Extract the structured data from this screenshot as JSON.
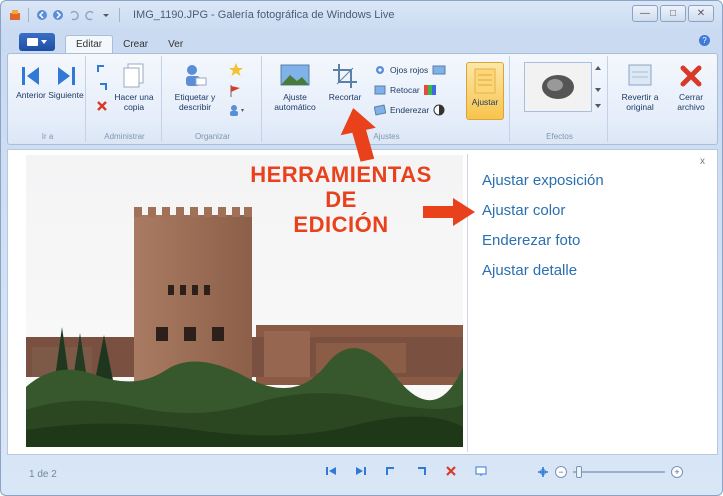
{
  "window": {
    "title": "IMG_1190.JPG - Galería fotográfica de Windows Live",
    "controls": [
      "minimize",
      "maximize",
      "close"
    ]
  },
  "tabs": [
    {
      "label": "Editar",
      "active": true
    },
    {
      "label": "Crear",
      "active": false
    },
    {
      "label": "Ver",
      "active": false
    }
  ],
  "ribbon": {
    "groups": {
      "navigate": {
        "label": "Ir a",
        "prev": "Anterior",
        "next": "Siguiente"
      },
      "manage": {
        "label": "Administrar",
        "copy": "Hacer una\ncopia"
      },
      "organize": {
        "label": "Organizar",
        "tag": "Etiquetar y\ndescribir"
      },
      "adjust": {
        "label": "Ajustes",
        "auto": "Ajuste\nautomático",
        "crop": "Recortar",
        "redeye": "Ojos rojos",
        "retouch": "Retocar",
        "straighten": "Enderezar",
        "adjust_btn": "Ajustar"
      },
      "effects": {
        "label": "Efectos"
      },
      "revert": {
        "label": "Revertir a\noriginal"
      },
      "close": {
        "label": "Cerrar\narchivo"
      }
    }
  },
  "annotation": {
    "text": [
      "HERRAMIENTAS",
      "DE",
      "EDICIÓN"
    ],
    "color": "#e9411c"
  },
  "panel": {
    "links": [
      "Ajustar exposición",
      "Ajustar color",
      "Enderezar foto",
      "Ajustar detalle"
    ],
    "close": "x"
  },
  "status": {
    "page_count": "1 de 2"
  },
  "colors": {
    "accent": "#2a6fb0",
    "ribbon_active": "#f8c44b",
    "annotation": "#e9411c"
  }
}
